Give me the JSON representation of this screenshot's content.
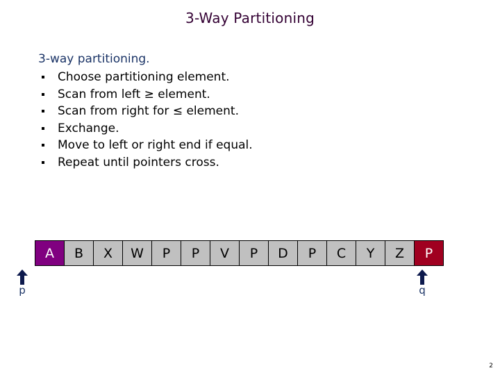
{
  "slide": {
    "title": "3-Way Partitioning",
    "intro": "3-way partitioning.",
    "bullets": [
      "Choose partitioning element.",
      "Scan from left ≥ element.",
      "Scan from right for ≤  element.",
      "Exchange.",
      "Move to left or right end if equal.",
      "Repeat until pointers cross."
    ],
    "array": {
      "cells": [
        "A",
        "B",
        "X",
        "W",
        "P",
        "P",
        "V",
        "P",
        "D",
        "P",
        "C",
        "Y",
        "Z",
        "P"
      ],
      "highlight_start_index": 0,
      "highlight_end_index": 13,
      "colors": {
        "default_cell": "#c0c0c0",
        "start_highlight": "#800080",
        "end_highlight": "#a00020"
      }
    },
    "pointers": {
      "left": {
        "label": "p",
        "icon": "up-arrow-icon",
        "index": 0
      },
      "right": {
        "label": "q",
        "icon": "up-arrow-icon",
        "index": 13
      }
    },
    "page_number": "2"
  }
}
